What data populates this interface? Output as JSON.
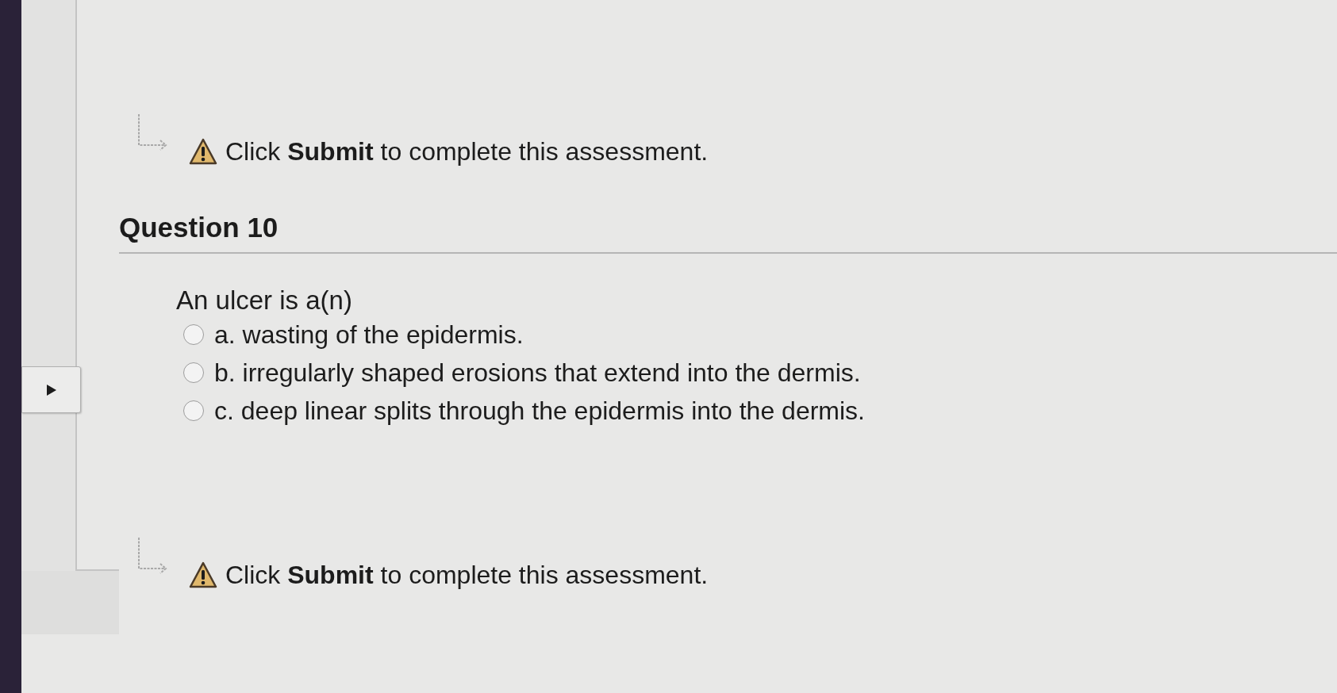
{
  "top_notice": {
    "text": "Click **Submit** to complete this assessment."
  },
  "question": {
    "heading": "Question 10",
    "prompt": "An ulcer is a(n)",
    "options": [
      {
        "label": "a. wasting of the epidermis.",
        "selected": false
      },
      {
        "label": "b. irregularly shaped erosions that extend into the dermis.",
        "selected": false
      },
      {
        "label": "c. deep linear splits through the epidermis into the dermis.",
        "selected": false
      }
    ]
  },
  "bottom_notice": {
    "text": "Click **Submit** to complete this assessment."
  }
}
